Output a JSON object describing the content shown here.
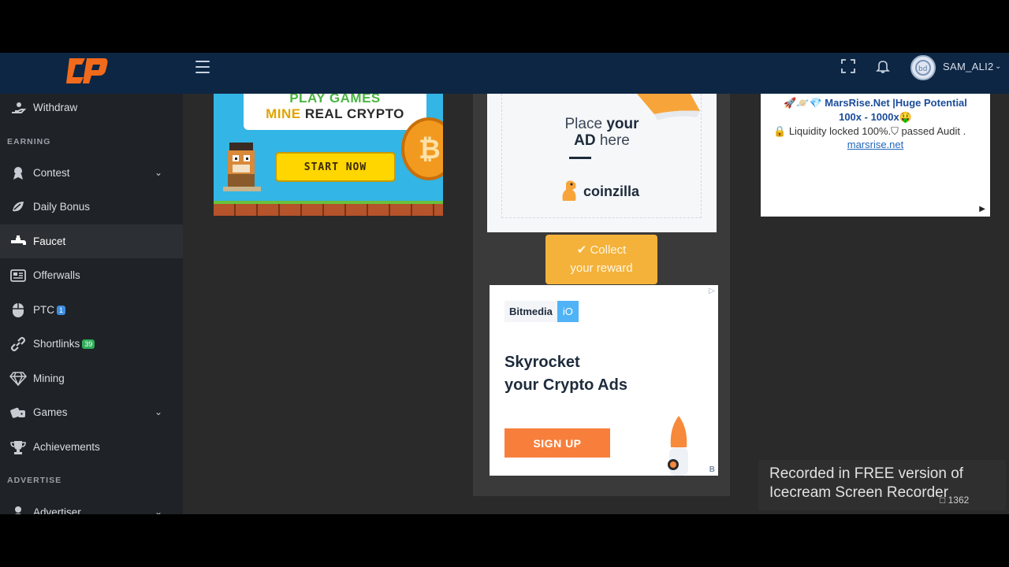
{
  "topbar": {
    "username": "SAM_ALI2",
    "icons": [
      "menu-icon",
      "fullscreen-icon",
      "bell-icon",
      "avatar",
      "chevron-down-icon"
    ],
    "brand_color": "#f26a1b",
    "bg_color": "#0d2644"
  },
  "sidebar": {
    "items": [
      {
        "label": "Withdraw",
        "icon": "withdraw-icon"
      },
      {
        "label": "Contest",
        "icon": "medal-icon",
        "has_caret": true
      },
      {
        "label": "Daily Bonus",
        "icon": "bonus-icon"
      },
      {
        "label": "Faucet",
        "icon": "faucet-icon",
        "active": true
      },
      {
        "label": "Offerwalls",
        "icon": "offerwalls-icon"
      },
      {
        "label": "PTC",
        "icon": "mouse-icon",
        "badge": "1",
        "badge_color": "#3d8de0"
      },
      {
        "label": "Shortlinks",
        "icon": "link-icon",
        "badge": "39",
        "badge_color": "#2fae5a"
      },
      {
        "label": "Mining",
        "icon": "diamond-icon"
      },
      {
        "label": "Games",
        "icon": "dice-icon",
        "has_caret": true
      },
      {
        "label": "Achievements",
        "icon": "trophy-icon"
      },
      {
        "label": "Advertiser",
        "icon": "user-icon",
        "has_caret": true
      }
    ],
    "sections": {
      "earning": "EARNING",
      "advertise": "ADVERTISE"
    }
  },
  "ads": {
    "game": {
      "line1": "PLAY GAMES",
      "line2_a": "MINE",
      "line2_b": "REAL CRYPTO",
      "button": "START NOW"
    },
    "coinzilla": {
      "line1_a": "Place ",
      "line1_b": "your",
      "line2_a": "AD",
      "line2_b": " here",
      "brand": "coinzilla"
    },
    "bitmedia": {
      "logo_a": "Bitmedia",
      "logo_b": "iO",
      "headline_1": "Skyrocket",
      "headline_2": "your Crypto Ads",
      "button": "SIGN UP",
      "corner": "B"
    },
    "marsrise": {
      "line1": "MarsRise.Net |Huge Potential",
      "line2": "100x - 1000x",
      "line3": "Liquidity locked 100%.⛉ passed Audit .",
      "link": "marsrise.net"
    }
  },
  "collect": {
    "line1": "Collect",
    "line2": "your reward"
  },
  "watermark": {
    "line1": "Recorded in FREE version of",
    "line2": "Icecream  Screen  Recorder",
    "count": "1362"
  }
}
